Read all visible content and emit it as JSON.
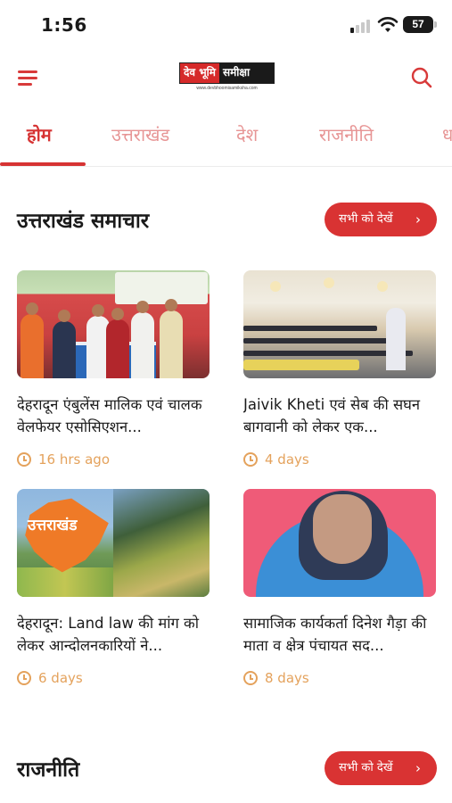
{
  "status_bar": {
    "time": "1:56",
    "battery": "57"
  },
  "header": {
    "logo_part1": "देव भूमि",
    "logo_part2": "समीक्षा",
    "logo_url": "www.devbhoomisamiksha.com"
  },
  "tabs": [
    {
      "label": "होम",
      "active": true
    },
    {
      "label": "उत्तराखंड",
      "active": false
    },
    {
      "label": "देश",
      "active": false
    },
    {
      "label": "राजनीति",
      "active": false
    },
    {
      "label": "ध",
      "active": false
    }
  ],
  "sections": [
    {
      "title": "उत्तराखंड समाचार",
      "see_all": "सभी को देखें",
      "articles": [
        {
          "title": "देहरादून एंबुलेंस मालिक एवं चालक वेलफेयर एसोसिएशन...",
          "time": "16 hrs ago"
        },
        {
          "title": "Jaivik Kheti एवं सेब की सघन बागवानी को लेकर एक...",
          "time": "4 days"
        },
        {
          "title": "देहरादून: Land law की मांग को लेकर आन्दोलनकारियों ने...",
          "time": "6 days",
          "image_text": "उत्तराखंड"
        },
        {
          "title": "सामाजिक कार्यकर्ता दिनेश गैड़ा की माता व क्षेत्र पंचायत सद...",
          "time": "8 days"
        }
      ]
    },
    {
      "title": "राजनीति",
      "see_all": "सभी को देखें"
    }
  ],
  "colors": {
    "accent": "#d63333",
    "tab_inactive": "#e79595",
    "time_meta": "#e4a25c"
  }
}
